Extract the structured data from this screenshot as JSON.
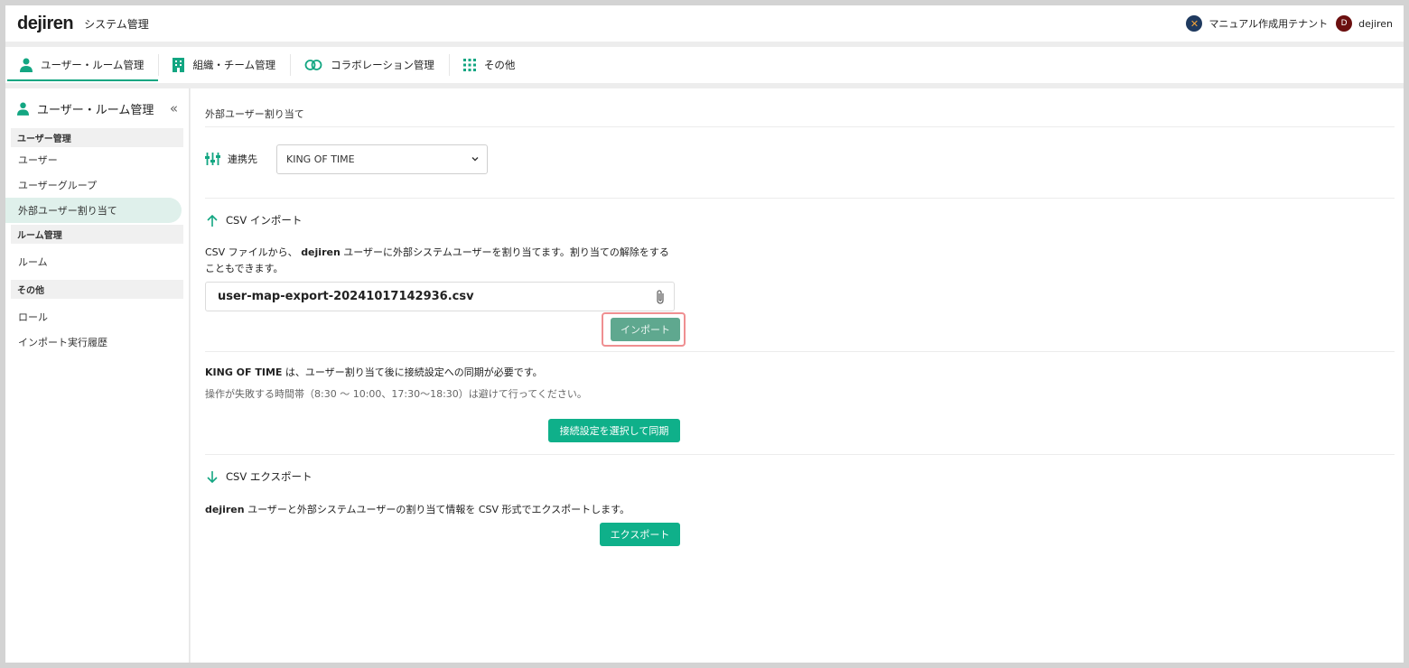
{
  "header": {
    "logo": "dejiren",
    "app_title": "システム管理",
    "tenant_name": "マニュアル作成用テナント",
    "avatar_initial": "D",
    "user_name": "dejiren"
  },
  "nav": {
    "tabs": [
      {
        "label": "ユーザー・ルーム管理",
        "active": true
      },
      {
        "label": "組織・チーム管理"
      },
      {
        "label": "コラボレーション管理"
      },
      {
        "label": "その他"
      }
    ]
  },
  "sidebar": {
    "title": "ユーザー・ルーム管理",
    "collapse_glyph": "«",
    "sections": [
      {
        "title": "ユーザー管理",
        "items": [
          "ユーザー",
          "ユーザーグループ",
          "外部ユーザー割り当て"
        ]
      },
      {
        "title": "ルーム管理",
        "items": [
          "ルーム"
        ]
      },
      {
        "title": "その他",
        "items": [
          "ロール",
          "インポート実行履歴"
        ]
      }
    ]
  },
  "main": {
    "breadcrumb": "外部ユーザー割り当て",
    "connection": {
      "label": "連携先",
      "selected": "KING OF TIME"
    },
    "csv_import": {
      "title": "CSV インポート",
      "desc_pre": "CSV ファイルから、 ",
      "desc_bold": "dejiren",
      "desc_post": " ユーザーに外部システムユーザーを割り当てます。割り当ての解除をすることもできます。",
      "file_name": "user-map-export-20241017142936.csv",
      "import_button": "インポート"
    },
    "sync": {
      "note_bold": "KING OF TIME",
      "note_rest": " は、ユーザー割り当て後に接続設定への同期が必要です。",
      "warning": "操作が失敗する時間帯（8:30 ～ 10:00、17:30～18:30）は避けて行ってください。",
      "button": "接続設定を選択して同期"
    },
    "csv_export": {
      "title": "CSV エクスポート",
      "desc_bold": "dejiren",
      "desc_rest": " ユーザーと外部システムユーザーの割り当て情報を CSV 形式でエクスポートします。",
      "button": "エクスポート"
    }
  },
  "colors": {
    "accent": "#0fb08a",
    "import_button": "#5fa88f",
    "highlight_outline": "#ef8f91"
  }
}
